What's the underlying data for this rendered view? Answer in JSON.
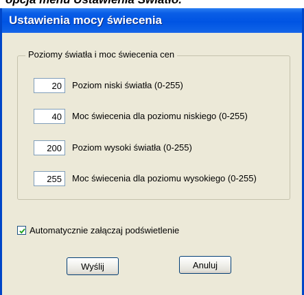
{
  "caption": "opcja menu Ustawienia Światło.",
  "window": {
    "title": "Ustawienia mocy świecenia"
  },
  "group": {
    "title": "Poziomy światła i moc świecenia cen",
    "fields": [
      {
        "value": "20",
        "label": "Poziom niski światła (0-255)"
      },
      {
        "value": "40",
        "label": "Moc świecenia dla poziomu niskiego (0-255)"
      },
      {
        "value": "200",
        "label": "Poziom wysoki światła (0-255)"
      },
      {
        "value": "255",
        "label": "Moc świecenia dla poziomu wysokiego (0-255)"
      }
    ]
  },
  "checkbox": {
    "label": "Automatycznie załączaj podświetlenie",
    "checked": true
  },
  "buttons": {
    "send": "Wyślij",
    "cancel": "Anuluj"
  }
}
